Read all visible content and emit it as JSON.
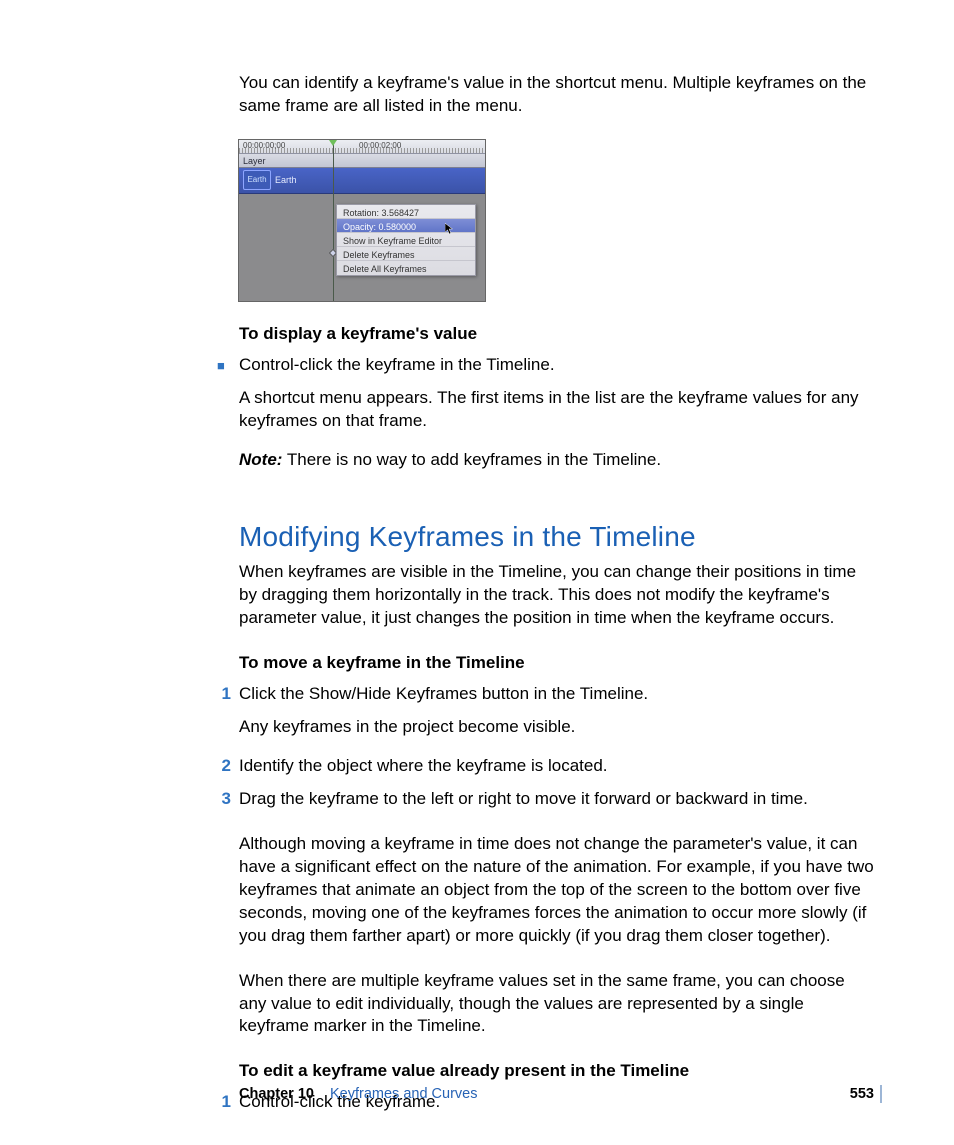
{
  "intro": {
    "para1": "You can identify a keyframe's value in the shortcut menu. Multiple keyframes on the same frame are all listed in the menu."
  },
  "figure": {
    "timecode1": "00:00:00;00",
    "timecode2": "00:00:02;00",
    "layer_label": "Layer",
    "track_name": "Earth",
    "menu": {
      "rotation": "Rotation: 3.568427",
      "opacity": "Opacity: 0.580000",
      "show": "Show in Keyframe Editor",
      "delete": "Delete Keyframes",
      "delete_all": "Delete All Keyframes"
    }
  },
  "display_section": {
    "heading": "To display a keyframe's value",
    "bullet1": "Control-click the keyframe in the Timeline.",
    "result": "A shortcut menu appears. The first items in the list are the keyframe values for any keyframes on that frame.",
    "note_label": "Note:",
    "note_body": "  There is no way to add keyframes in the Timeline."
  },
  "modify_section": {
    "heading": "Modifying Keyframes in the Timeline",
    "intro": "When keyframes are visible in the Timeline, you can change their positions in time by dragging them horizontally in the track. This does not modify the keyframe's parameter value, it just changes the position in time when the keyframe occurs.",
    "move_heading": "To move a keyframe in the Timeline",
    "step1": "Click the Show/Hide Keyframes button in the Timeline.",
    "step1_result": "Any keyframes in the project become visible.",
    "step2": "Identify the object where the keyframe is located.",
    "step3": "Drag the keyframe to the left or right to move it forward or backward in time.",
    "para_after": "Although moving a keyframe in time does not change the parameter's value, it can have a significant effect on the nature of the animation. For example, if you have two keyframes that animate an object from the top of the screen to the bottom over five seconds, moving one of the keyframes forces the animation to occur more slowly (if you drag them farther apart) or more quickly (if you drag them closer together).",
    "para_multi": "When there are multiple keyframe values set in the same frame, you can choose any value to edit individually, though the values are represented by a single keyframe marker in the Timeline.",
    "edit_heading": "To edit a keyframe value already present in the Timeline",
    "edit_step1": "Control-click the keyframe."
  },
  "footer": {
    "chapter_label": "Chapter 10",
    "chapter_title": "Keyframes and Curves",
    "page_number": "553"
  },
  "list_numbers": {
    "n1": "1",
    "n2": "2",
    "n3": "3"
  }
}
